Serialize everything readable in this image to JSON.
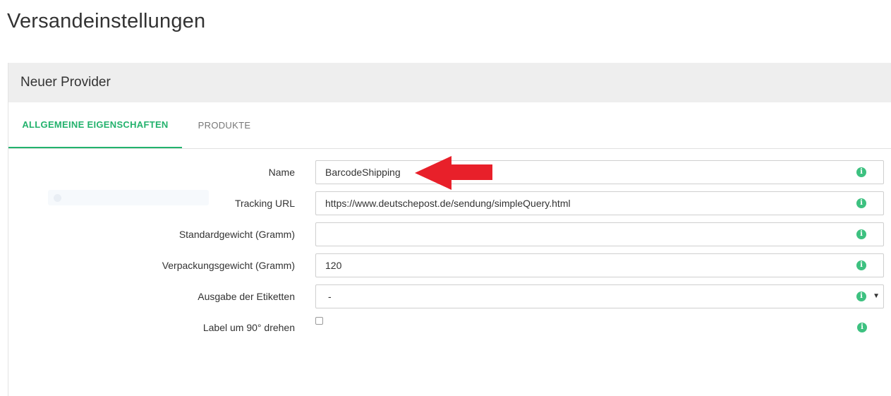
{
  "page": {
    "title": "Versandeinstellungen"
  },
  "panel": {
    "title": "Neuer Provider",
    "tabs": [
      {
        "label": "ALLGEMEINE EIGENSCHAFTEN",
        "active": true
      },
      {
        "label": "PRODUKTE",
        "active": false
      }
    ]
  },
  "form": {
    "name": {
      "label": "Name",
      "value": "BarcodeShipping",
      "placeholder": ""
    },
    "tracking_url": {
      "label": "Tracking URL",
      "value": "https://www.deutschepost.de/sendung/simpleQuery.html",
      "placeholder": ""
    },
    "standard_weight": {
      "label": "Standardgewicht (Gramm)",
      "value": "",
      "placeholder": ""
    },
    "packaging_weight": {
      "label": "Verpackungsgewicht (Gramm)",
      "value": "120",
      "placeholder": ""
    },
    "label_output": {
      "label": "Ausgabe der Etiketten",
      "selected": "-"
    },
    "rotate_label": {
      "label": "Label um 90° drehen",
      "checked": false
    }
  },
  "icons": {
    "info": "info-icon",
    "caret": "chevron-down-icon",
    "annotation": "red-arrow-icon"
  },
  "colors": {
    "accent": "#23b26d",
    "info": "#3dc180",
    "arrow": "#e8202a",
    "header_bg": "#eeeeee"
  }
}
